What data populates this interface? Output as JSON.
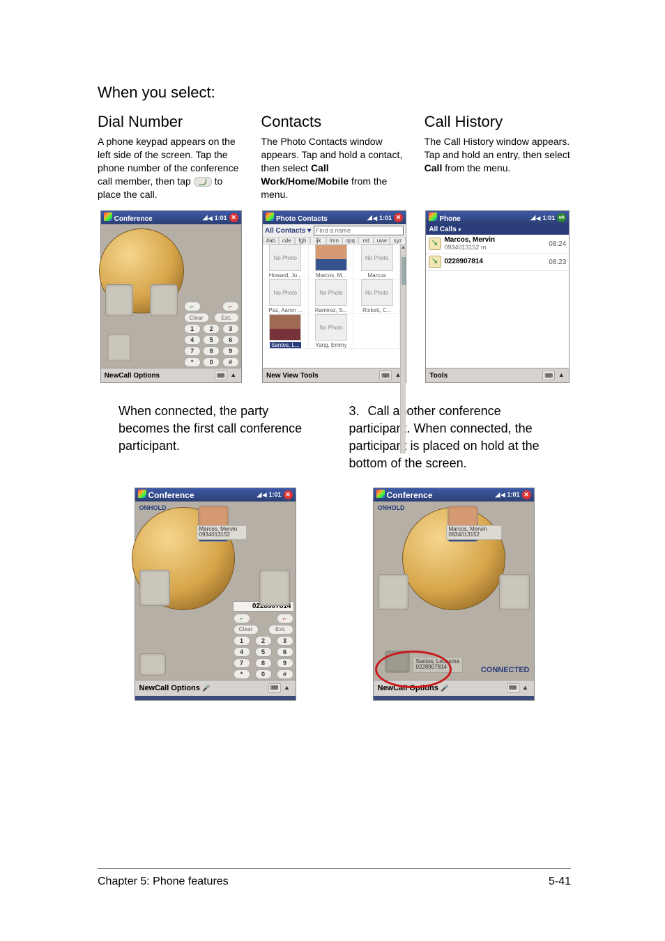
{
  "intro": "When you select:",
  "columns": {
    "dial": {
      "title": "Dial Number",
      "body_before": "A phone keypad appears on the left side of the screen. Tap the phone number of the conference call member, then tap ",
      "body_after": " to place the call."
    },
    "contacts": {
      "title": "Contacts",
      "body": "The Photo Contacts window appears. Tap and hold a contact, then select ",
      "bold": "Call Work/Home/Mobile",
      "tail": " from the menu."
    },
    "history": {
      "title": "Call History",
      "body": "The Call History window appears. Tap and hold an entry, then select ",
      "bold": "Call",
      "tail": " from the menu."
    }
  },
  "conf_small": {
    "title": "Conference",
    "time": "1:01",
    "footer": "NewCall Options",
    "keys": {
      "clear": "Clear",
      "ext": "Ext.",
      "r1": [
        "1",
        "2",
        "3"
      ],
      "r2": [
        "4",
        "5",
        "6"
      ],
      "r3": [
        "7",
        "8",
        "9"
      ],
      "r4": [
        "*",
        "0",
        "#"
      ]
    }
  },
  "photo_contacts": {
    "title": "Photo Contacts",
    "time": "1:01",
    "dropdown": "All Contacts",
    "find_placeholder": "Find a name",
    "alpha": [
      "#ab",
      "cde",
      "fgh",
      "ijk",
      "lmn",
      "opq",
      "rst",
      "uvw",
      "xyz"
    ],
    "cells": [
      {
        "label": "No Photo",
        "name": "Howard, Jo..."
      },
      {
        "label": "",
        "name": "Marcos, M...",
        "photo": true
      },
      {
        "label": "No Photo",
        "name": "Marcus"
      },
      {
        "label": "No Photo",
        "name": "Paz, Aaron ..."
      },
      {
        "label": "No Photo",
        "name": "Ramirez, S..."
      },
      {
        "label": "No Photo",
        "name": "Rickett, C..."
      },
      {
        "label": "",
        "name": "Santos, L...",
        "photo2": true,
        "sel": true
      },
      {
        "label": "No Photo",
        "name": "Yang, Emmy"
      }
    ],
    "footer": "New View Tools"
  },
  "call_history": {
    "title": "Phone",
    "time": "1:01",
    "dropdown": "All Calls",
    "rows": [
      {
        "name": "Marcos, Mervin",
        "sub": "0934013152 m",
        "time": "08:24"
      },
      {
        "name": "0228907814",
        "sub": "",
        "time": "08:23"
      }
    ],
    "footer": "Tools"
  },
  "mid_text": {
    "left": "When connected, the party becomes the first call conference participant.",
    "right_num": "3.",
    "right": "Call another conference participant. When connected, the participant is placed on hold at the bottom of the screen."
  },
  "conf_md1": {
    "title": "Conference",
    "time": "1:01",
    "onhold": "ONHOLD",
    "name": "Marcos, Mervin",
    "number_sub": "0934013152",
    "dial_display": "0228907814",
    "keys": {
      "clear": "Clear",
      "ext": "Ext.",
      "r1": [
        "1",
        "2",
        "3"
      ],
      "r2": [
        "4",
        "5",
        "6"
      ],
      "r3": [
        "7",
        "8",
        "9"
      ],
      "r4": [
        "*",
        "0",
        "#"
      ]
    },
    "footer": "NewCall Options"
  },
  "conf_md2": {
    "title": "Conference",
    "time": "1:01",
    "onhold": "ONHOLD",
    "name": "Marcos, Mervin",
    "number_sub": "0934013152",
    "bottom_name": "Santos, Ledesma",
    "bottom_number": "0228907814",
    "connected": "CONNECTED",
    "footer": "NewCall Options"
  },
  "footer": {
    "left": "Chapter 5: Phone features",
    "right": "5-41"
  }
}
